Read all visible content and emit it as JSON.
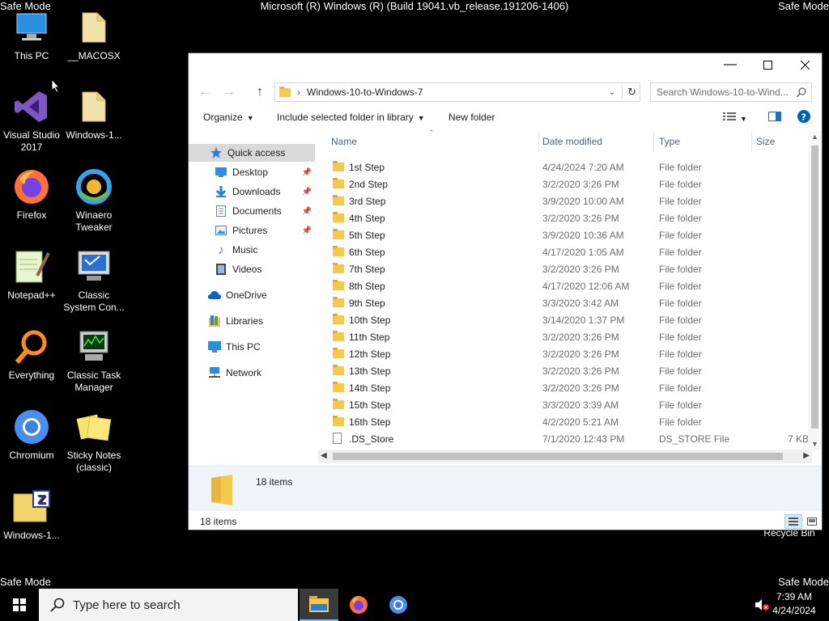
{
  "safe_mode": "Safe Mode",
  "build_text": "Microsoft (R) Windows (R) (Build 19041.vb_release.191206-1406)",
  "desktop_icons": [
    {
      "label": "This PC",
      "icon": "this-pc-icon"
    },
    {
      "label": "__MACOSX",
      "icon": "folder-icon"
    },
    {
      "label": "Visual Studio 2017",
      "icon": "visual-studio-icon"
    },
    {
      "label": "Windows-1...",
      "icon": "folder-icon"
    },
    {
      "label": "Firefox",
      "icon": "firefox-icon"
    },
    {
      "label": "Winaero Tweaker",
      "icon": "winaero-icon"
    },
    {
      "label": "Notepad++",
      "icon": "notepad-plus-plus-icon"
    },
    {
      "label": "Classic System Con...",
      "icon": "system-config-icon"
    },
    {
      "label": "Everything",
      "icon": "everything-search-icon"
    },
    {
      "label": "Classic Task Manager",
      "icon": "task-manager-icon"
    },
    {
      "label": "Chromium",
      "icon": "chromium-icon"
    },
    {
      "label": "Sticky Notes (classic)",
      "icon": "sticky-notes-icon"
    },
    {
      "label": "Windows-1...",
      "icon": "zip-folder-icon"
    },
    {
      "label": "Recycle Bin",
      "icon": "recycle-bin-icon"
    }
  ],
  "explorer": {
    "address": "Windows-10-to-Windows-7",
    "search_placeholder": "Search Windows-10-to-Wind...",
    "toolbar": {
      "organize": "Organize",
      "include": "Include selected folder in library",
      "new_folder": "New folder"
    },
    "nav": [
      {
        "label": "Quick access",
        "icon": "star-icon",
        "pinned": false
      },
      {
        "label": "Desktop",
        "icon": "desktop-icon",
        "pinned": true
      },
      {
        "label": "Downloads",
        "icon": "download-icon",
        "pinned": true
      },
      {
        "label": "Documents",
        "icon": "document-icon",
        "pinned": true
      },
      {
        "label": "Pictures",
        "icon": "pictures-icon",
        "pinned": true
      },
      {
        "label": "Music",
        "icon": "music-icon",
        "pinned": false
      },
      {
        "label": "Videos",
        "icon": "videos-icon",
        "pinned": false
      },
      {
        "label": "OneDrive",
        "icon": "cloud-icon",
        "pinned": false
      },
      {
        "label": "Libraries",
        "icon": "libraries-icon",
        "pinned": false
      },
      {
        "label": "This PC",
        "icon": "computer-icon",
        "pinned": false
      },
      {
        "label": "Network",
        "icon": "network-icon",
        "pinned": false
      }
    ],
    "columns": {
      "name": "Name",
      "date": "Date modified",
      "type": "Type",
      "size": "Size"
    },
    "files": [
      {
        "name": "1st Step",
        "date": "4/24/2024 7:20 AM",
        "type": "File folder",
        "size": ""
      },
      {
        "name": "2nd Step",
        "date": "3/2/2020 3:26 PM",
        "type": "File folder",
        "size": ""
      },
      {
        "name": "3rd Step",
        "date": "3/9/2020 10:00 AM",
        "type": "File folder",
        "size": ""
      },
      {
        "name": "4th Step",
        "date": "3/2/2020 3:26 PM",
        "type": "File folder",
        "size": ""
      },
      {
        "name": "5th Step",
        "date": "3/9/2020 10:36 AM",
        "type": "File folder",
        "size": ""
      },
      {
        "name": "6th Step",
        "date": "4/17/2020 1:05 AM",
        "type": "File folder",
        "size": ""
      },
      {
        "name": "7th Step",
        "date": "3/2/2020 3:26 PM",
        "type": "File folder",
        "size": ""
      },
      {
        "name": "8th Step",
        "date": "4/17/2020 12:06 AM",
        "type": "File folder",
        "size": ""
      },
      {
        "name": "9th Step",
        "date": "3/3/2020 3:42 AM",
        "type": "File folder",
        "size": ""
      },
      {
        "name": "10th Step",
        "date": "3/14/2020 1:37 PM",
        "type": "File folder",
        "size": ""
      },
      {
        "name": "11th Step",
        "date": "3/2/2020 3:26 PM",
        "type": "File folder",
        "size": ""
      },
      {
        "name": "12th Step",
        "date": "3/2/2020 3:26 PM",
        "type": "File folder",
        "size": ""
      },
      {
        "name": "13th Step",
        "date": "3/2/2020 3:26 PM",
        "type": "File folder",
        "size": ""
      },
      {
        "name": "14th Step",
        "date": "3/2/2020 3:26 PM",
        "type": "File folder",
        "size": ""
      },
      {
        "name": "15th Step",
        "date": "3/3/2020 3:39 AM",
        "type": "File folder",
        "size": ""
      },
      {
        "name": "16th Step",
        "date": "4/2/2020 5:21 AM",
        "type": "File folder",
        "size": ""
      },
      {
        "name": ".DS_Store",
        "date": "7/1/2020 12:43 PM",
        "type": "DS_STORE File",
        "size": "7 KB"
      }
    ],
    "details_count": "18 items",
    "status_count": "18 items"
  },
  "taskbar": {
    "search_placeholder": "Type here to search",
    "time": "7:39 AM",
    "date": "4/24/2024"
  },
  "colors": {
    "accent": "#0078d7",
    "folder": "#f4c94e",
    "selection": "#cce8ff"
  }
}
